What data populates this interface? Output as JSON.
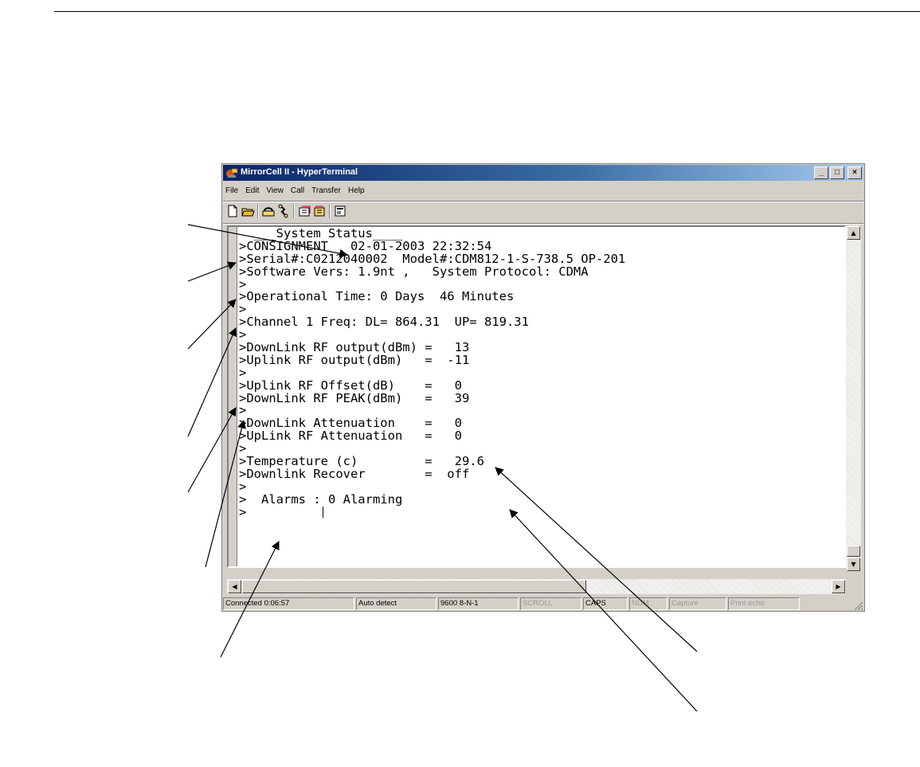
{
  "window": {
    "title": "MirrorCell II - HyperTerminal"
  },
  "menu": [
    "File",
    "Edit",
    "View",
    "Call",
    "Transfer",
    "Help"
  ],
  "toolbar_icons": [
    "new-icon",
    "open-icon",
    "connect-icon",
    "disconnect-icon",
    "send-icon",
    "receive-icon",
    "properties-icon"
  ],
  "terminal": {
    "lines": [
      "  ___System Status____",
      ">CONSIGNMENT   02-01-2003 22:32:54",
      ">Serial#:C0212040002  Model#:CDM812-1-S-738.5 OP-201",
      ">Software Vers: 1.9nt ,   System Protocol: CDMA",
      ">",
      ">Operational Time: 0 Days  46 Minutes",
      ">",
      ">Channel 1 Freq: DL= 864.31  UP= 819.31",
      ">",
      ">DownLink RF output(dBm) =   13",
      ">Uplink RF output(dBm)   =  -11",
      ">",
      ">Uplink RF Offset(dB)    =   0",
      ">DownLink RF PEAK(dBm)   =   39",
      ">",
      ">DownLink Attenuation    =   0",
      ">UpLink RF Attenuation   =   0",
      ">",
      ">Temperature (c)         =   29.6",
      ">Downlink Recover        =  off",
      ">",
      ">  Alarms : 0 Alarming",
      ">          "
    ]
  },
  "status": {
    "connected": "Connected 0:06:57",
    "detect": "Auto detect",
    "settings": "9600 8-N-1",
    "scroll": "SCROLL",
    "caps": "CAPS",
    "num": "NUM",
    "capture": "Capture",
    "print_echo": "Print echo"
  },
  "colors": {
    "titlebar_start": "#0a246a",
    "titlebar_end": "#a6caf0",
    "chrome": "#d4d0c8"
  }
}
